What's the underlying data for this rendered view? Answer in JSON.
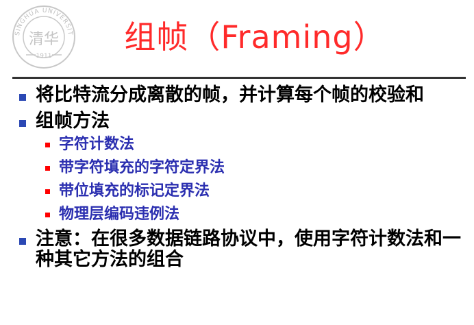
{
  "slide": {
    "title": "组帧（Framing）",
    "logo": {
      "text_top": "TSINGHUA UNIVERSITY",
      "year": "1911",
      "seal_chars": "清华"
    },
    "colors": {
      "title": "#ff2a2a",
      "level1_text": "#000000",
      "level1_bullet": "#2b48b4",
      "level2_text": "#2b2fb0",
      "level2_bullet": "#ff0000"
    },
    "items": [
      {
        "text": "将比特流分成离散的帧，并计算每个帧的校验和"
      },
      {
        "text": "组帧方法",
        "subitems": [
          "字符计数法",
          "带字符填充的字符定界法",
          "带位填充的标记定界法",
          "物理层编码违例法"
        ]
      },
      {
        "text": "注意：在很多数据链路协议中，使用字符计数法和一种其它方法的组合"
      }
    ]
  }
}
